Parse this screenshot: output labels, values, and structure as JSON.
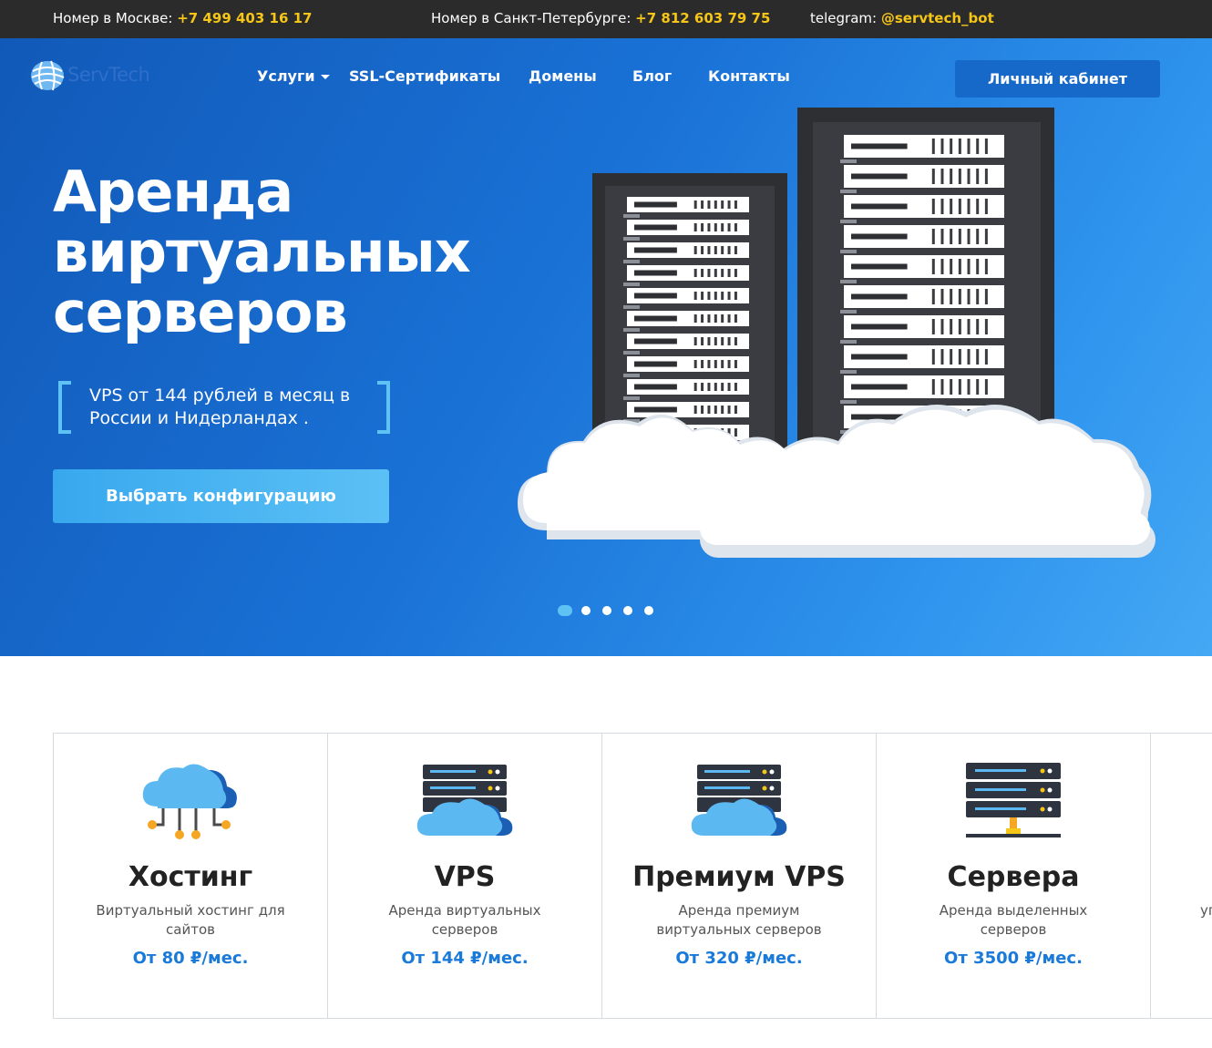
{
  "topbar": {
    "moscow_label": "Номер в Москве:",
    "moscow_phone": "+7 499 403 16 17",
    "spb_label": "Номер в Санкт-Петербурге:",
    "spb_phone": "+7 812 603 79 75",
    "telegram_label": "telegram:",
    "telegram_handle": "@servtech_bot"
  },
  "header": {
    "logo_text": "ServTech",
    "nav": [
      "Услуги",
      "SSL-Сертификаты",
      "Домены",
      "Блог",
      "Контакты"
    ],
    "cabinet_label": "Личный кабинет"
  },
  "hero": {
    "title_lines": [
      "Аренда",
      "виртуальных",
      "серверов"
    ],
    "subtitle": "VPS от 144 рублей в месяц в России и Нидерландах .",
    "cta_label": "Выбрать конфигурацию",
    "slides_total": 5,
    "active_slide": 1
  },
  "cards": [
    {
      "icon": "cloud-network-icon",
      "title": "Хостинг",
      "desc": "Виртуальный хостинг для сайтов",
      "price": "От 80 ₽/мес."
    },
    {
      "icon": "server-cloud-icon",
      "title": "VPS",
      "desc": "Аренда виртуальных серверов",
      "price": "От 144 ₽/мес."
    },
    {
      "icon": "server-cloud-icon",
      "title": "Премиум VPS",
      "desc": "Аренда премиум виртуальных серверов",
      "price": "От 320 ₽/мес."
    },
    {
      "icon": "server-rack-icon",
      "title": "Сервера",
      "desc": "Аренда выделенных серверов",
      "price": "От 3500 ₽/мес."
    },
    {
      "icon": "",
      "title": "",
      "desc": "уп",
      "price": ""
    }
  ],
  "colors": {
    "accent_yellow": "#f5c518",
    "brand_blue": "#1669c9",
    "price_blue": "#1a7ad9",
    "light_blue": "#5fc2f5"
  }
}
